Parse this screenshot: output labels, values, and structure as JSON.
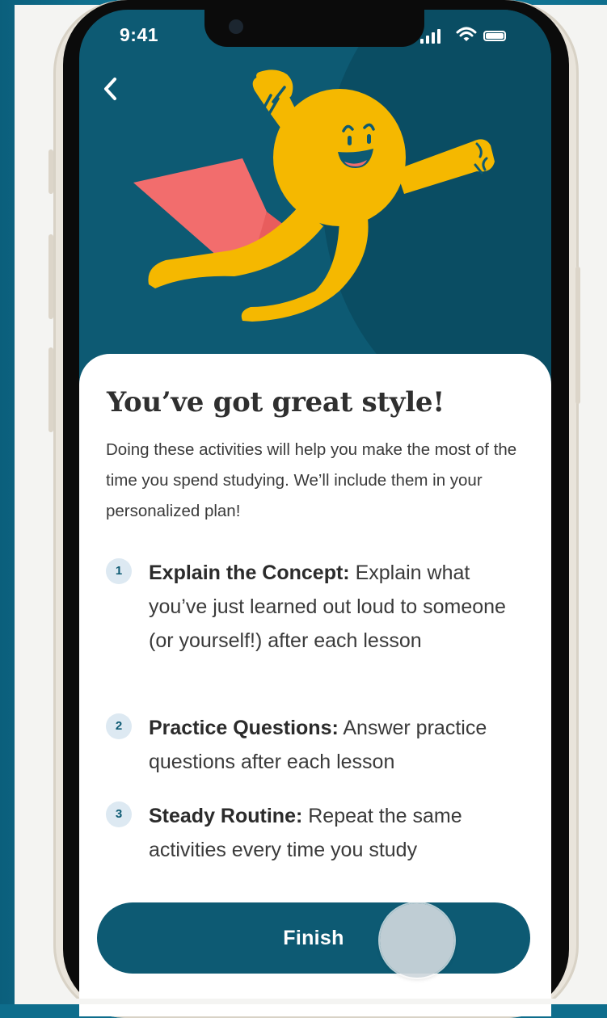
{
  "status_bar": {
    "time": "9:41"
  },
  "content": {
    "title": "You’ve got great style!",
    "intro": "Doing these activities will help you make the most of the time you spend studying. We’ll include them in your personalized plan!",
    "items": [
      {
        "number": "1",
        "heading": "Explain the Concept:",
        "text": " Explain what you’ve just learned out loud to someone (or yourself!) after each lesson"
      },
      {
        "number": "2",
        "heading": "Practice Questions:",
        "text": " Answer practice questions after each lesson"
      },
      {
        "number": "3",
        "heading": "Steady Routine:",
        "text": " Repeat the same activities every time you study"
      }
    ]
  },
  "actions": {
    "finish_label": "Finish"
  },
  "colors": {
    "primary": "#0d5a73",
    "mascot": "#f5b800",
    "cape": "#f26d6d",
    "card": "#ffffff",
    "number_badge": "#dde9f2"
  },
  "icons": {
    "back": "chevron-left-icon",
    "signal": "signal-icon",
    "wifi": "wifi-icon",
    "battery": "battery-icon"
  }
}
